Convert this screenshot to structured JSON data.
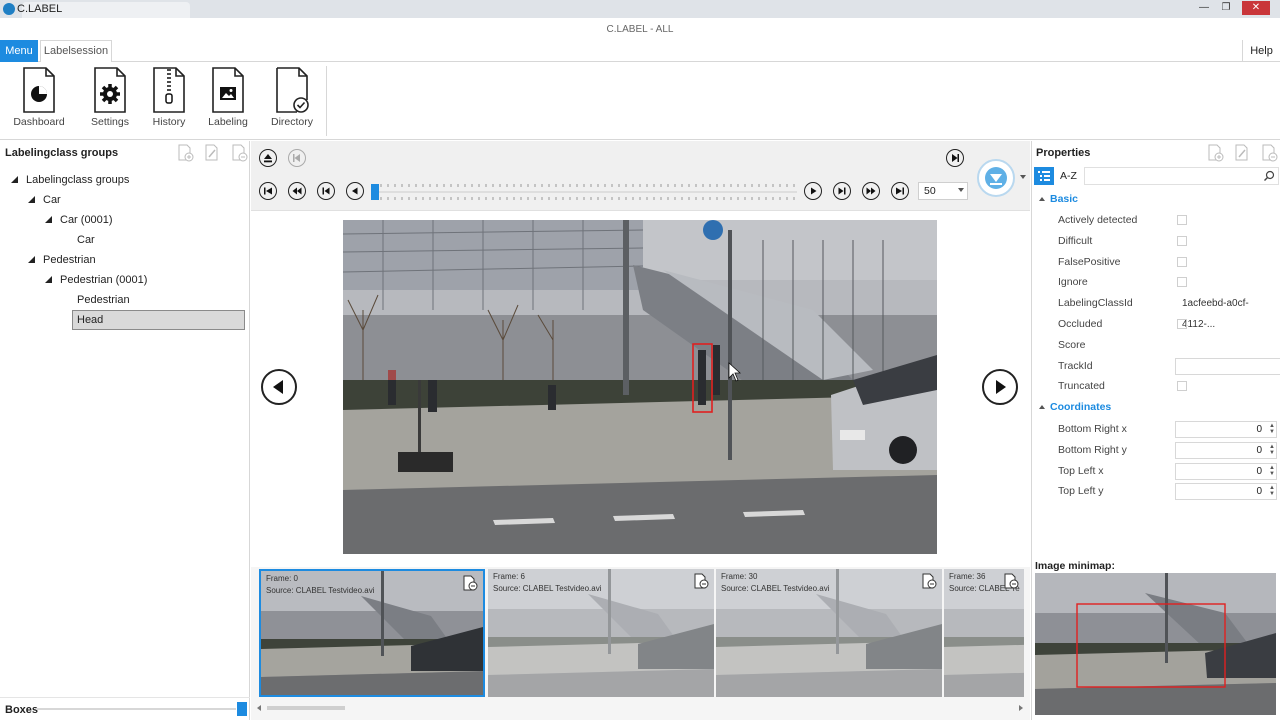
{
  "window": {
    "app_name": "C.LABEL",
    "title": "C.LABEL - ALL",
    "minimize": "—",
    "maximize": "❐",
    "close": "✕"
  },
  "ribbon_tabs": {
    "menu": "Menu",
    "labelsession": "Labelsession",
    "help": "Help"
  },
  "ribbon": {
    "items": [
      {
        "label": "Dashboard",
        "icon": "pie-chart-icon"
      },
      {
        "label": "Settings",
        "icon": "gear-icon"
      },
      {
        "label": "History",
        "icon": "zip-icon"
      },
      {
        "label": "Labeling",
        "icon": "image-icon"
      },
      {
        "label": "Directory",
        "icon": "check-icon"
      }
    ]
  },
  "left_panel": {
    "title": "Labelingclass groups",
    "tree": [
      {
        "label": "Labelingclass groups",
        "level": 0,
        "expanded": true
      },
      {
        "label": "Car",
        "level": 1,
        "expanded": true
      },
      {
        "label": "Car (0001)",
        "level": 2,
        "expanded": true
      },
      {
        "label": "Car",
        "level": 3
      },
      {
        "label": "Pedestrian",
        "level": 1,
        "expanded": true
      },
      {
        "label": "Pedestrian (0001)",
        "level": 2,
        "expanded": true
      },
      {
        "label": "Pedestrian",
        "level": 3
      },
      {
        "label": "Head",
        "level": 3,
        "selected": true
      }
    ],
    "boxes_label": "Boxes"
  },
  "player": {
    "speed": "50",
    "timeline_position": 0.0
  },
  "thumbnails": [
    {
      "frame": "Frame: 0",
      "source": "Source: CLABEL Testvideo.avi",
      "selected": true
    },
    {
      "frame": "Frame: 6",
      "source": "Source: CLABEL Testvideo.avi"
    },
    {
      "frame": "Frame: 30",
      "source": "Source: CLABEL Testvideo.avi"
    },
    {
      "frame": "Frame: 36",
      "source": "Source: CLABEL Te"
    }
  ],
  "properties": {
    "title": "Properties",
    "sort_az": "A-Z",
    "groups": {
      "basic": "Basic",
      "coordinates": "Coordinates"
    },
    "basic_rows": [
      {
        "name": "Actively detected",
        "type": "check"
      },
      {
        "name": "Difficult",
        "type": "check"
      },
      {
        "name": "FalsePositive",
        "type": "check"
      },
      {
        "name": "Ignore",
        "type": "check"
      },
      {
        "name": "LabelingClassId",
        "type": "value",
        "value": "1acfeebd-a0cf-4112-..."
      },
      {
        "name": "Occluded",
        "type": "check"
      },
      {
        "name": "Score",
        "type": "none"
      },
      {
        "name": "TrackId",
        "type": "text"
      },
      {
        "name": "Truncated",
        "type": "check"
      }
    ],
    "coord_rows": [
      {
        "name": "Bottom Right x",
        "value": "0"
      },
      {
        "name": "Bottom Right y",
        "value": "0"
      },
      {
        "name": "Top Left x",
        "value": "0"
      },
      {
        "name": "Top Left y",
        "value": "0"
      }
    ],
    "minimap_title": "Image minimap:"
  },
  "colors": {
    "accent": "#1d8be0",
    "annotation_box": "#e02020"
  }
}
